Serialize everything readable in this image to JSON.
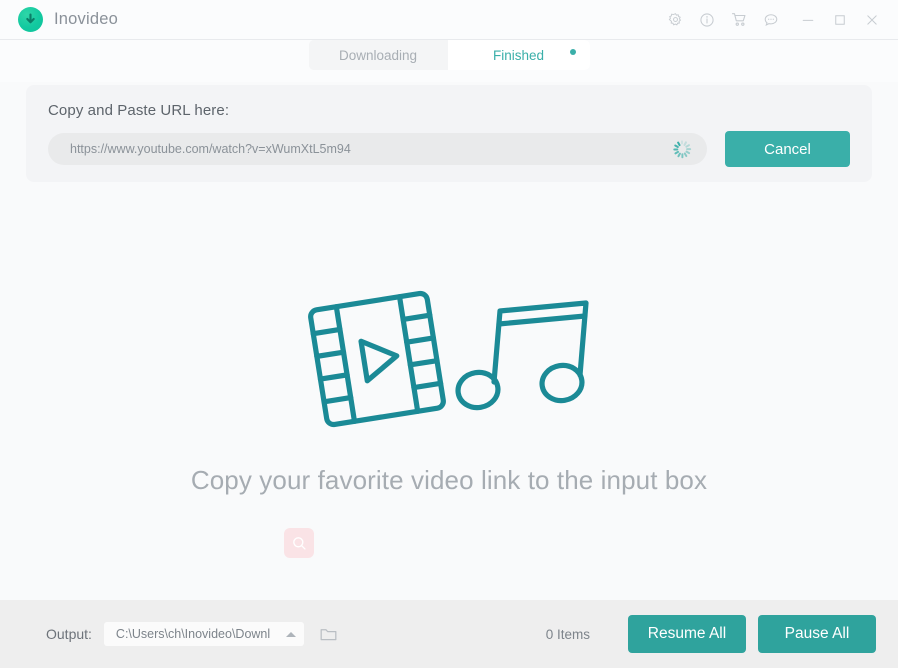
{
  "window": {
    "title": "Inovideo",
    "logo_icon": "download-circle-logo",
    "controls": [
      {
        "name": "settings-gear-icon",
        "label": "Settings"
      },
      {
        "name": "info-icon",
        "label": "Info"
      },
      {
        "name": "cart-icon",
        "label": "Store"
      },
      {
        "name": "feedback-chat-icon",
        "label": "Feedback"
      },
      {
        "name": "minimize-icon",
        "label": "Minimize"
      },
      {
        "name": "maximize-icon",
        "label": "Maximize"
      },
      {
        "name": "close-icon",
        "label": "Close"
      }
    ]
  },
  "tabs": [
    {
      "label": "Downloading",
      "active": false,
      "badge": false
    },
    {
      "label": "Finished",
      "active": true,
      "badge": true
    }
  ],
  "url_panel": {
    "label": "Copy and Paste URL here:",
    "input_value": "https://www.youtube.com/watch?v=xWumXtL5m94",
    "input_placeholder": "https://www.youtube.com/watch?v=xWumXtL5m94",
    "spinner_icon": "loading-spinner-icon",
    "cancel_label": "Cancel"
  },
  "empty_state": {
    "illustration_icon": "video-music-illustration",
    "message": "Copy your favorite video link to the input box",
    "search_icon": "search-icon"
  },
  "footer": {
    "output_label": "Output:",
    "output_path": "C:\\Users\\ch\\Inovideo\\Downl",
    "caret_icon": "chevron-up-icon",
    "folder_icon": "folder-icon",
    "items_count": "0 Items",
    "resume_all_label": "Resume All",
    "pause_all_label": "Pause All"
  },
  "colors": {
    "accent_teal": "#3AAFA9",
    "accent_teal_dark": "#2FA39D",
    "logo_green": "#12C9A0",
    "panel_gray": "#F3F4F6",
    "footer_gray": "#EEEEEE",
    "text_gray": "#A6ACB2",
    "search_chip_pink": "#FAE3E6"
  }
}
